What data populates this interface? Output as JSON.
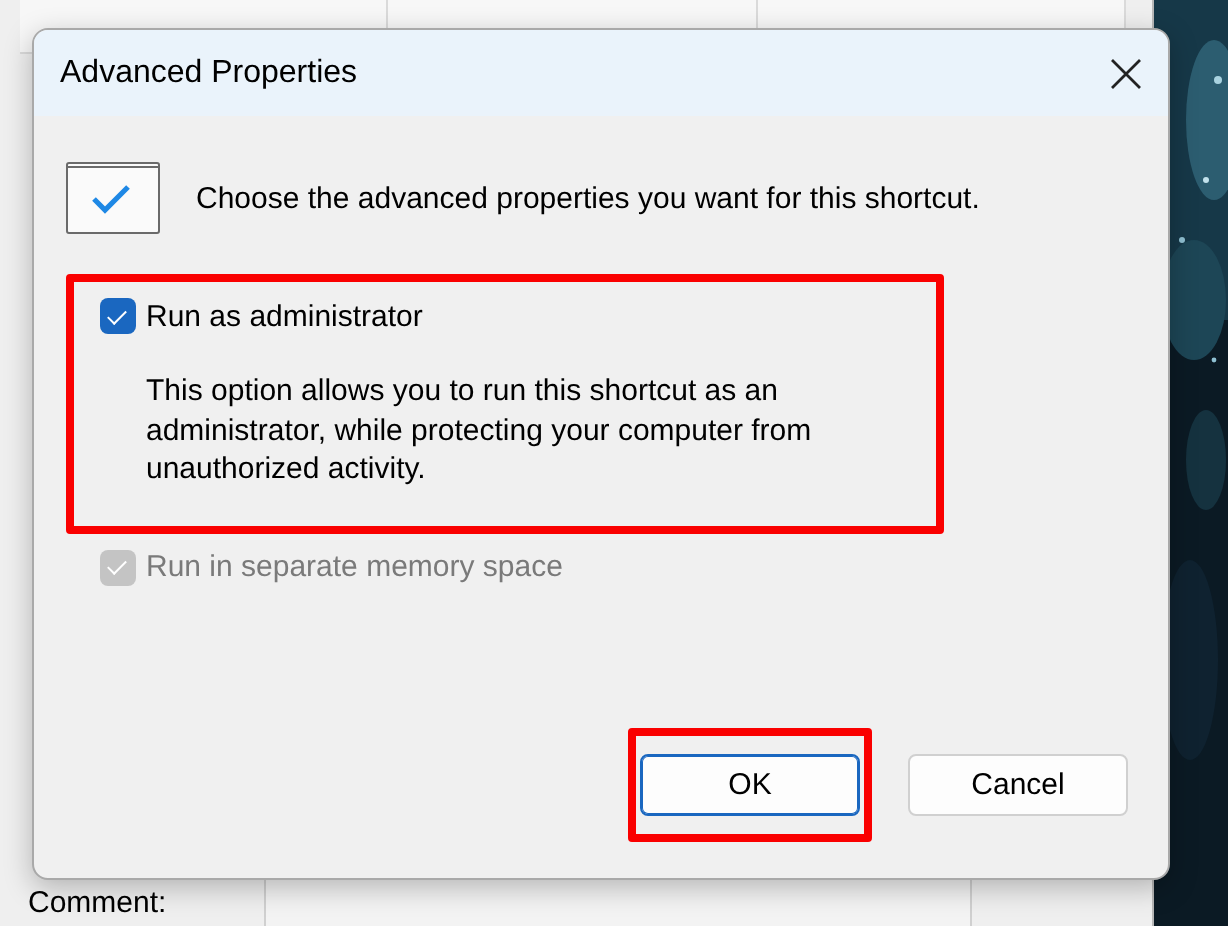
{
  "background_window": {
    "comment_label": "Comment:"
  },
  "dialog": {
    "title": "Advanced Properties",
    "intro": "Choose the advanced properties you want for this shortcut.",
    "options": [
      {
        "label": "Run as administrator",
        "description": "This option allows you to run this shortcut as an administrator, while protecting your computer from unauthorized activity.",
        "checked": true,
        "disabled": false,
        "highlighted": true
      },
      {
        "label": "Run in separate memory space",
        "checked": true,
        "disabled": true,
        "highlighted": false
      }
    ],
    "buttons": [
      {
        "label": "OK",
        "default": true,
        "highlighted": true
      },
      {
        "label": "Cancel",
        "default": false,
        "highlighted": false
      }
    ]
  }
}
